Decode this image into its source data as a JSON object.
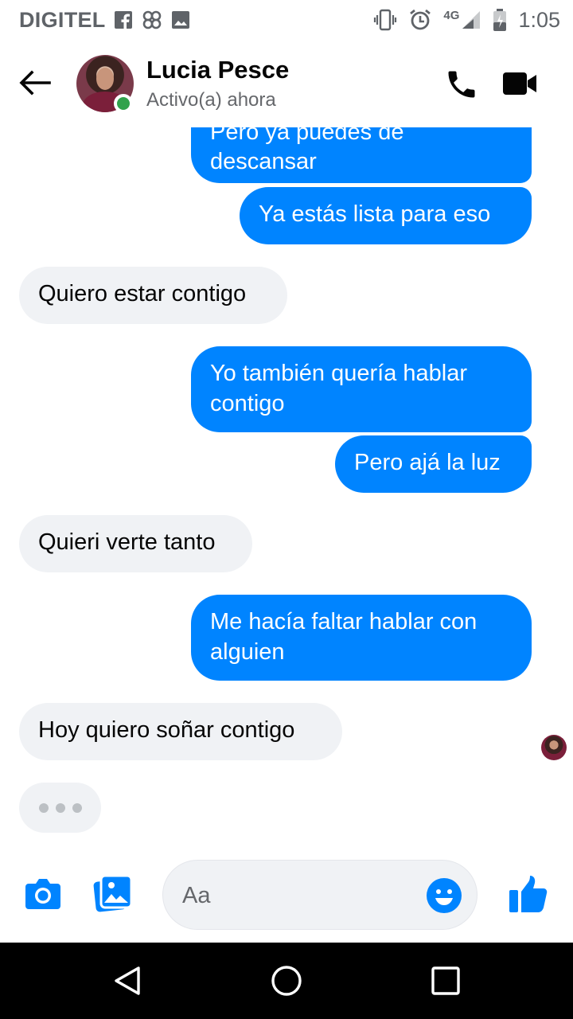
{
  "status_bar": {
    "carrier": "DIGITEL",
    "network": "4G",
    "time": "1:05",
    "icons": [
      "facebook-icon",
      "pinwheel-icon",
      "image-icon",
      "vibrate-icon",
      "alarm-icon",
      "signal-icon",
      "battery-icon"
    ]
  },
  "header": {
    "contact_name": "Lucia Pesce",
    "contact_status": "Activo(a) ahora",
    "online": true,
    "icons": [
      "back-arrow-icon",
      "phone-icon",
      "video-camera-icon"
    ]
  },
  "messages": [
    {
      "direction": "outgoing",
      "text_lines": [
        "Pero ya puedes de",
        "descansar"
      ]
    },
    {
      "direction": "outgoing",
      "text_lines": [
        "Ya estás lista para eso"
      ]
    },
    {
      "direction": "incoming",
      "text_lines": [
        "Quiero estar contigo"
      ]
    },
    {
      "direction": "outgoing",
      "text_lines": [
        "Yo también quería hablar",
        "contigo"
      ]
    },
    {
      "direction": "outgoing",
      "text_lines": [
        "Pero ajá la luz"
      ]
    },
    {
      "direction": "incoming",
      "text_lines": [
        "Quieri verte tanto"
      ]
    },
    {
      "direction": "outgoing",
      "text_lines": [
        "Me hacía faltar hablar con",
        "alguien"
      ]
    },
    {
      "direction": "incoming",
      "text_lines": [
        "Hoy quiero soñar contigo"
      ]
    }
  ],
  "typing_indicator": true,
  "composer": {
    "placeholder": "Aa",
    "value": "",
    "icons": [
      "camera-icon",
      "gallery-icon",
      "emoji-icon",
      "thumbs-up-icon"
    ]
  },
  "colors": {
    "accent": "#0084FF",
    "incoming_bubble": "#F0F2F5",
    "online": "#31A24C",
    "navbar": "#000000"
  },
  "nav_bar": {
    "icons": [
      "nav-back-icon",
      "nav-home-icon",
      "nav-recents-icon"
    ]
  }
}
